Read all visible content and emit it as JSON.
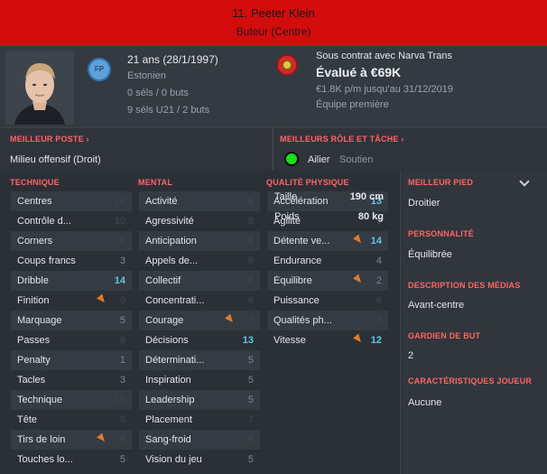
{
  "header": {
    "player_name": "11. Peeter Klein",
    "position": "Buteur (Centre)"
  },
  "profile": {
    "badge_label": "FP",
    "age_line": "21 ans (28/1/1997)",
    "nationality": "Estonien",
    "caps": "0 séls / 0 buts",
    "u21_caps": "9 séls U21 / 2 buts",
    "contract": "Sous contrat avec Narva Trans",
    "value": "Évalué à €69K",
    "wage": "€1.8K p/m jusqu'au 31/12/2019",
    "squad": "Équipe première"
  },
  "best_position": {
    "title": "MEILLEUR POSTE",
    "value": "Milieu offensif (Droit)"
  },
  "best_role": {
    "title": "MEILLEURS RÔLE ET TÂCHE",
    "role": "Ailier",
    "duty": "Soutien"
  },
  "technical": {
    "title": "TECHNIQUE",
    "rows": [
      {
        "name": "Centres",
        "value": "10"
      },
      {
        "name": "Contrôle d...",
        "value": "10"
      },
      {
        "name": "Corners",
        "value": "6"
      },
      {
        "name": "Coups francs",
        "value": "3"
      },
      {
        "name": "Dribble",
        "value": "14"
      },
      {
        "name": "Finition",
        "value": "9"
      },
      {
        "name": "Marquage",
        "value": "5"
      },
      {
        "name": "Passes",
        "value": "8"
      },
      {
        "name": "Penalty",
        "value": "1"
      },
      {
        "name": "Tacles",
        "value": "3"
      },
      {
        "name": "Technique",
        "value": "10"
      },
      {
        "name": "Tête",
        "value": "8"
      },
      {
        "name": "Tirs de loin",
        "value": "8"
      },
      {
        "name": "Touches lo...",
        "value": "5"
      }
    ]
  },
  "mental": {
    "title": "MENTAL",
    "rows": [
      {
        "name": "Activité",
        "value": "8"
      },
      {
        "name": "Agressivité",
        "value": "8"
      },
      {
        "name": "Anticipation",
        "value": "8"
      },
      {
        "name": "Appels de...",
        "value": "8"
      },
      {
        "name": "Collectif",
        "value": "8"
      },
      {
        "name": "Concentrati...",
        "value": "6"
      },
      {
        "name": "Courage",
        "value": "7"
      },
      {
        "name": "Décisions",
        "value": "13"
      },
      {
        "name": "Déterminati...",
        "value": "5"
      },
      {
        "name": "Inspiration",
        "value": "5"
      },
      {
        "name": "Leadership",
        "value": "5"
      },
      {
        "name": "Placement",
        "value": "7"
      },
      {
        "name": "Sang-froid",
        "value": "8"
      },
      {
        "name": "Vision du jeu",
        "value": "5"
      }
    ]
  },
  "physical": {
    "title": "QUALITÉ PHYSIQUE",
    "rows": [
      {
        "name": "Accélération",
        "value": "13"
      },
      {
        "name": "Agilité",
        "value": "9"
      },
      {
        "name": "Détente ve...",
        "value": "14"
      },
      {
        "name": "Endurance",
        "value": "4"
      },
      {
        "name": "Équilibre",
        "value": "2"
      },
      {
        "name": "Puissance",
        "value": "6"
      },
      {
        "name": "Qualités ph...",
        "value": "8"
      },
      {
        "name": "Vitesse",
        "value": "12"
      }
    ],
    "height_label": "Taille",
    "height_value": "190 cm",
    "weight_label": "Poids",
    "weight_value": "80 kg"
  },
  "side": {
    "foot_title": "MEILLEUR PIED",
    "foot_value": "Droitier",
    "personality_title": "PERSONNALITÉ",
    "personality_value": "Équilibrée",
    "media_title": "DESCRIPTION DES MÉDIAS",
    "media_value": "Avant-centre",
    "gk_title": "GARDIEN DE BUT",
    "gk_value": "2",
    "traits_title": "CARACTÉRISTIQUES JOUEUR",
    "traits_value": "Aucune"
  },
  "colors": {
    "header": "#d30c0c",
    "section_title": "#ff6565",
    "highlight_value": "#5fc6e8",
    "role_dot": "#16e016",
    "trend_arrow": "#e07a2a"
  }
}
